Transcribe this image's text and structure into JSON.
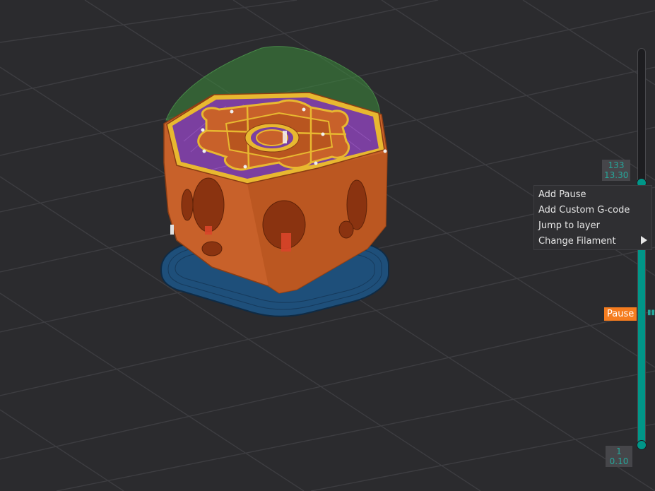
{
  "viewport": {
    "background_color": "#2b2b2e",
    "grid_color": "#3d3d41"
  },
  "layer_slider": {
    "top_layer": "133",
    "top_height": "13.30",
    "bottom_layer": "1",
    "bottom_height": "0.10",
    "accent_color": "#009688",
    "pause_marker_label": "Pause",
    "pause_marker_color": "#f57c1f"
  },
  "context_menu": {
    "items": [
      {
        "label": "Add Pause"
      },
      {
        "label": "Add Custom G-code"
      },
      {
        "label": "Jump to layer"
      },
      {
        "label": "Change Filament",
        "submenu_icon": "triangle-right-icon"
      }
    ]
  },
  "model_colors": {
    "outer_wall": "#c8612a",
    "infill": "#7b3fa0",
    "inner_wall": "#e8b830",
    "brim": "#1e4f7a",
    "preview_shell": "#3c8c3c"
  }
}
